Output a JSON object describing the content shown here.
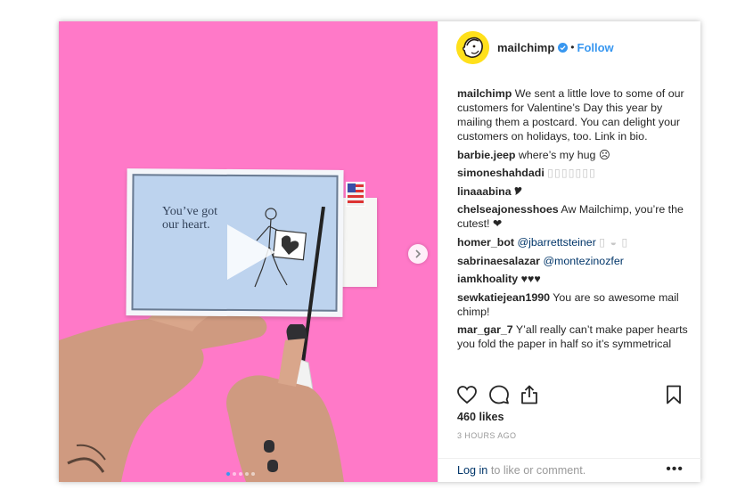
{
  "post": {
    "username": "mailchimp",
    "follow_label": "Follow",
    "separator": "•",
    "postcard_text_line1": "You’ve got",
    "postcard_text_line2": "our heart.",
    "carousel_count": 5,
    "carousel_active": 0
  },
  "comments": [
    {
      "user": "mailchimp",
      "text": "We sent a little love to some of our customers for Valentine’s Day this year by mailing them a postcard. You can delight your customers on holidays, too. Link in bio."
    },
    {
      "user": "barbie.jeep",
      "text": "where’s my hug ☹"
    },
    {
      "user": "simoneshahdadi",
      "faint": "▯▯▯▯▯▯▯"
    },
    {
      "user": "linaaabina",
      "text": "🎔"
    },
    {
      "user": "chelseajonesshoes",
      "text": "Aw Mailchimp, you’re the cutest! ❤"
    },
    {
      "user": "homer_bot",
      "mention": "@jbarrettsteiner",
      "faint": "▯ ◒ ▯"
    },
    {
      "user": "sabrinaesalazar",
      "mention": "@montezinozfer"
    },
    {
      "user": "iamkhoality",
      "text": "♥♥♥"
    },
    {
      "user": "sewkatiejean1990",
      "text": "You are so awesome mail chimp!"
    },
    {
      "user": "mar_gar_7",
      "text": "Y’all really can’t make paper hearts you fold the paper in half so it’s symmetrical"
    }
  ],
  "likes": "460 likes",
  "time": "3 HOURS AGO",
  "bottom": {
    "login": "Log in",
    "rest": " to like or comment.",
    "more": "•••"
  },
  "colors": {
    "background": "#ff79c8",
    "accent": "#3897f0",
    "brand_yellow": "#ffe01b"
  },
  "icons": {
    "like": "heart-icon",
    "comment": "comment-icon",
    "share": "share-icon",
    "save": "bookmark-icon",
    "play": "play-icon",
    "next": "chevron-right-icon",
    "verified": "verified-badge-icon"
  }
}
